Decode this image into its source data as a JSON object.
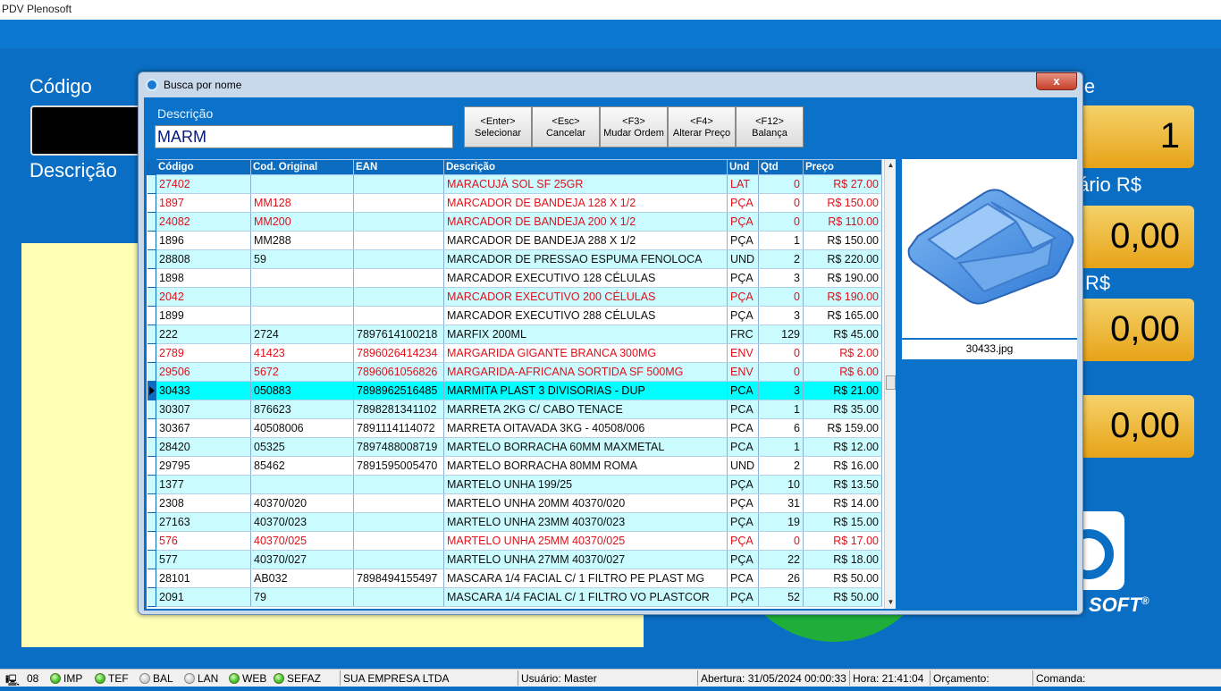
{
  "app": {
    "title": "PDV Plenosoft"
  },
  "main": {
    "codigo_label": "Código",
    "descricao_label": "Descrição",
    "partial_label_1": "le",
    "partial_label_2": "tário R$",
    "partial_label_3": "R$",
    "qty_value": "1",
    "unit_value": "0,00",
    "total_value": "0,00",
    "sub_value": "0,00",
    "logo_text": "SOFT",
    "logo_mark": "®"
  },
  "dialog": {
    "title": "Busca por nome",
    "close_label": "x",
    "descricao_label": "Descrição",
    "search_value": "MARM",
    "buttons": [
      {
        "key": "<Enter>",
        "label": "Selecionar"
      },
      {
        "key": "<Esc>",
        "label": "Cancelar"
      },
      {
        "key": "<F3>",
        "label": "Mudar Ordem"
      },
      {
        "key": "<F4>",
        "label": "Alterar Preço"
      },
      {
        "key": "<F12>",
        "label": "Balança"
      }
    ],
    "columns": [
      "Código",
      "Cod. Original",
      "EAN",
      "Descrição",
      "Und",
      "Qtd",
      "Preço"
    ],
    "rows": [
      {
        "codigo": "27402",
        "original": "",
        "ean": "",
        "descricao": "MARACUJÁ SOL SF 25GR",
        "und": "LAT",
        "qtd": "0",
        "preco": "R$ 27.00",
        "red": true
      },
      {
        "codigo": "1897",
        "original": "MM128",
        "ean": "",
        "descricao": "MARCADOR DE BANDEJA 128 X 1/2",
        "und": "PÇA",
        "qtd": "0",
        "preco": "R$ 150.00",
        "red": true
      },
      {
        "codigo": "24082",
        "original": "MM200",
        "ean": "",
        "descricao": "MARCADOR DE BANDEJA 200 X 1/2",
        "und": "PÇA",
        "qtd": "0",
        "preco": "R$ 110.00",
        "red": true
      },
      {
        "codigo": "1896",
        "original": "MM288",
        "ean": "",
        "descricao": "MARCADOR DE BANDEJA 288 X 1/2",
        "und": "PÇA",
        "qtd": "1",
        "preco": "R$ 150.00",
        "red": false
      },
      {
        "codigo": "28808",
        "original": "59",
        "ean": "",
        "descricao": "MARCADOR DE PRESSAO ESPUMA FENOLOCA",
        "und": "UND",
        "qtd": "2",
        "preco": "R$ 220.00",
        "red": false
      },
      {
        "codigo": "1898",
        "original": "",
        "ean": "",
        "descricao": "MARCADOR EXECUTIVO 128 CÉLULAS",
        "und": "PÇA",
        "qtd": "3",
        "preco": "R$ 190.00",
        "red": false
      },
      {
        "codigo": "2042",
        "original": "",
        "ean": "",
        "descricao": "MARCADOR EXECUTIVO 200 CÉLULAS",
        "und": "PÇA",
        "qtd": "0",
        "preco": "R$ 190.00",
        "red": true
      },
      {
        "codigo": "1899",
        "original": "",
        "ean": "",
        "descricao": "MARCADOR EXECUTIVO 288 CÉLULAS",
        "und": "PÇA",
        "qtd": "3",
        "preco": "R$ 165.00",
        "red": false
      },
      {
        "codigo": "222",
        "original": "2724",
        "ean": "7897614100218",
        "descricao": "MARFIX 200ML",
        "und": "FRC",
        "qtd": "129",
        "preco": "R$ 45.00",
        "red": false
      },
      {
        "codigo": "2789",
        "original": "41423",
        "ean": "7896026414234",
        "descricao": "MARGARIDA GIGANTE BRANCA 300MG",
        "und": "ENV",
        "qtd": "0",
        "preco": "R$ 2.00",
        "red": true
      },
      {
        "codigo": "29506",
        "original": "5672",
        "ean": "7896061056826",
        "descricao": "MARGARIDA-AFRICANA SORTIDA SF 500MG",
        "und": "ENV",
        "qtd": "0",
        "preco": "R$ 6.00",
        "red": true
      },
      {
        "codigo": "30433",
        "original": "050883",
        "ean": "7898962516485",
        "descricao": "MARMITA PLAST 3 DIVISORIAS - DUP",
        "und": "PCA",
        "qtd": "3",
        "preco": "R$ 21.00",
        "red": false,
        "selected": true
      },
      {
        "codigo": "30307",
        "original": "876623",
        "ean": "7898281341102",
        "descricao": "MARRETA 2KG C/ CABO TENACE",
        "und": "PCA",
        "qtd": "1",
        "preco": "R$ 35.00",
        "red": false
      },
      {
        "codigo": "30367",
        "original": "40508006",
        "ean": "7891114114072",
        "descricao": "MARRETA OITAVADA 3KG - 40508/006",
        "und": "PCA",
        "qtd": "6",
        "preco": "R$ 159.00",
        "red": false
      },
      {
        "codigo": "28420",
        "original": "05325",
        "ean": "7897488008719",
        "descricao": "MARTELO BORRACHA 60MM MAXMETAL",
        "und": "PCA",
        "qtd": "1",
        "preco": "R$ 12.00",
        "red": false
      },
      {
        "codigo": "29795",
        "original": "85462",
        "ean": "7891595005470",
        "descricao": "MARTELO BORRACHA 80MM ROMA",
        "und": "UND",
        "qtd": "2",
        "preco": "R$ 16.00",
        "red": false
      },
      {
        "codigo": "1377",
        "original": "",
        "ean": "",
        "descricao": "MARTELO UNHA 199/25",
        "und": "PÇA",
        "qtd": "10",
        "preco": "R$ 13.50",
        "red": false
      },
      {
        "codigo": "2308",
        "original": "40370/020",
        "ean": "",
        "descricao": "MARTELO UNHA 20MM 40370/020",
        "und": "PÇA",
        "qtd": "31",
        "preco": "R$ 14.00",
        "red": false
      },
      {
        "codigo": "27163",
        "original": "40370/023",
        "ean": "",
        "descricao": "MARTELO UNHA 23MM 40370/023",
        "und": "PÇA",
        "qtd": "19",
        "preco": "R$ 15.00",
        "red": false
      },
      {
        "codigo": "576",
        "original": "40370/025",
        "ean": "",
        "descricao": "MARTELO UNHA 25MM 40370/025",
        "und": "PÇA",
        "qtd": "0",
        "preco": "R$ 17.00",
        "red": true
      },
      {
        "codigo": "577",
        "original": "40370/027",
        "ean": "",
        "descricao": "MARTELO UNHA 27MM 40370/027",
        "und": "PÇA",
        "qtd": "22",
        "preco": "R$ 18.00",
        "red": false
      },
      {
        "codigo": "28101",
        "original": "AB032",
        "ean": "7898494155497",
        "descricao": "MASCARA 1/4 FACIAL C/ 1 FILTRO PE PLAST MG",
        "und": "PCA",
        "qtd": "26",
        "preco": "R$ 50.00",
        "red": false
      },
      {
        "codigo": "2091",
        "original": "79",
        "ean": "",
        "descricao": "MASCARA 1/4 FACIAL C/ 1 FILTRO VO PLASTCOR",
        "und": "PÇA",
        "qtd": "52",
        "preco": "R$ 50.00",
        "red": false
      }
    ],
    "image_caption": "30433.jpg"
  },
  "status": {
    "terminal": "08",
    "indicators": [
      {
        "label": "IMP",
        "on": true
      },
      {
        "label": "TEF",
        "on": true
      },
      {
        "label": "BAL",
        "on": false
      },
      {
        "label": "LAN",
        "on": false
      },
      {
        "label": "WEB",
        "on": true
      },
      {
        "label": "SEFAZ",
        "on": true
      }
    ],
    "empresa": "SUA EMPRESA LTDA",
    "usuario": "Usuário: Master",
    "abertura": "Abertura: 31/05/2024 00:00:33",
    "hora": "Hora: 21:41:04",
    "orcamento": "Orçamento:",
    "comanda": "Comanda:"
  },
  "colors": {
    "background": "#0a6fc4",
    "grid_header": "#0b6cc0",
    "row_alt": "#c9fbff",
    "selected_row": "#00ffff",
    "zero_stock_text": "#e0101a",
    "amount_box": "#f0b733"
  }
}
